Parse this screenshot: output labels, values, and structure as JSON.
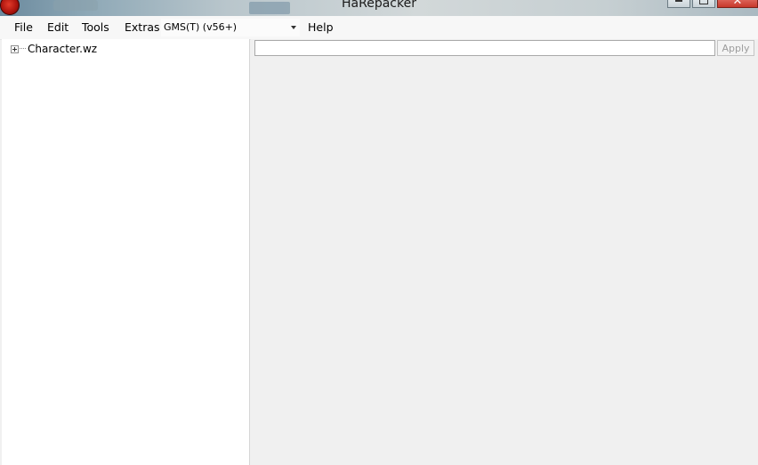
{
  "window": {
    "title": "HaRepacker",
    "close_glyph": "✕"
  },
  "menu": {
    "file": "File",
    "edit": "Edit",
    "tools": "Tools",
    "extras": "Extras",
    "version_selected": "GMS(T) (v56+)",
    "help": "Help"
  },
  "tree": {
    "nodes": [
      {
        "label": "Character.wz",
        "expanded": false
      }
    ]
  },
  "editor": {
    "value": "",
    "apply_label": "Apply",
    "apply_enabled": false
  },
  "colors": {
    "titlebar_close": "#c7382b",
    "tree_background": "#ffffff",
    "panel_background": "#f0f0f0",
    "disabled_text": "#9c9c9c"
  }
}
